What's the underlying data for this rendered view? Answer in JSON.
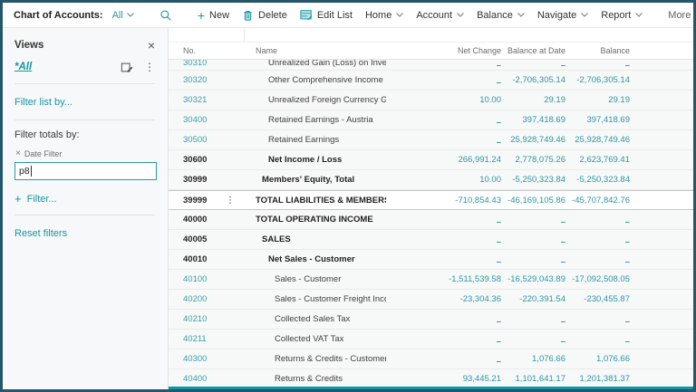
{
  "action_bar": {
    "page_title": "Chart of Accounts:",
    "view_selector": "All",
    "new_label": "New",
    "delete_label": "Delete",
    "edit_list_label": "Edit List",
    "menus": [
      "Home",
      "Account",
      "Balance",
      "Navigate",
      "Report"
    ],
    "more_options_label": "More options"
  },
  "side_pane": {
    "title": "Views",
    "view_all_label": "*All",
    "filter_list_label": "Filter list by...",
    "filter_totals_label": "Filter totals by:",
    "date_filter_chip": "Date Filter",
    "date_filter_value": "p8",
    "add_filter_label": "Filter...",
    "reset_filters_label": "Reset filters"
  },
  "table": {
    "columns": {
      "no": "No.",
      "name": "Name",
      "net_change": "Net Change",
      "balance_at_date": "Balance at Date",
      "balance": "Balance"
    },
    "rows": [
      {
        "no": "30310",
        "name": "Unrealized Gain (Loss) on Investment",
        "net_change": "–",
        "balance_at_date": "–",
        "balance": "–",
        "indent": 2,
        "bold": false,
        "clipped": true
      },
      {
        "no": "30320",
        "name": "Other Comprehensive Income",
        "net_change": "–",
        "balance_at_date": "-2,706,305.14",
        "balance": "-2,706,305.14",
        "indent": 2,
        "bold": false
      },
      {
        "no": "30321",
        "name": "Unrealized Foreign Currency Gain/Loss",
        "net_change": "10.00",
        "balance_at_date": "29.19",
        "balance": "29.19",
        "indent": 2,
        "bold": false
      },
      {
        "no": "30400",
        "name": "Retained Earnings - Austria",
        "net_change": "–",
        "balance_at_date": "397,418.69",
        "balance": "397,418.69",
        "indent": 2,
        "bold": false
      },
      {
        "no": "30500",
        "name": "Retained Earnings",
        "net_change": "–",
        "balance_at_date": "25,928,749.46",
        "balance": "25,928,749.46",
        "indent": 2,
        "bold": false
      },
      {
        "no": "30600",
        "name": "Net Income / Loss",
        "net_change": "266,991.24",
        "balance_at_date": "2,778,075.26",
        "balance": "2,623,769.41",
        "indent": 2,
        "bold": true
      },
      {
        "no": "30999",
        "name": "Members' Equity, Total",
        "net_change": "10.00",
        "balance_at_date": "-5,250,323.84",
        "balance": "-5,250,323.84",
        "indent": 1,
        "bold": true
      },
      {
        "no": "39999",
        "name": "TOTAL LIABILITIES & MEMBERS' EQUITY",
        "net_change": "-710,854.43",
        "balance_at_date": "-46,169,105.86",
        "balance": "-45,707,842.76",
        "indent": 0,
        "bold": true,
        "selected": true
      },
      {
        "no": "40000",
        "name": "TOTAL OPERATING INCOME",
        "net_change": "–",
        "balance_at_date": "–",
        "balance": "–",
        "indent": 0,
        "bold": true
      },
      {
        "no": "40005",
        "name": "SALES",
        "net_change": "–",
        "balance_at_date": "–",
        "balance": "–",
        "indent": 1,
        "bold": true
      },
      {
        "no": "40010",
        "name": "Net Sales - Customer",
        "net_change": "–",
        "balance_at_date": "–",
        "balance": "–",
        "indent": 2,
        "bold": true
      },
      {
        "no": "40100",
        "name": "Sales - Customer",
        "net_change": "-1,511,539.58",
        "balance_at_date": "-16,529,043.89",
        "balance": "-17,092,508.05",
        "indent": 3,
        "bold": false
      },
      {
        "no": "40200",
        "name": "Sales - Customer Freight Income",
        "net_change": "-23,304.36",
        "balance_at_date": "-220,391.54",
        "balance": "-230,455.87",
        "indent": 3,
        "bold": false
      },
      {
        "no": "40210",
        "name": "Collected Sales Tax",
        "net_change": "–",
        "balance_at_date": "–",
        "balance": "–",
        "indent": 3,
        "bold": false
      },
      {
        "no": "40211",
        "name": "Collected VAT Tax",
        "net_change": "–",
        "balance_at_date": "–",
        "balance": "–",
        "indent": 3,
        "bold": false
      },
      {
        "no": "40300",
        "name": "Returns & Credits - Customer Freight",
        "net_change": "–",
        "balance_at_date": "1,076.66",
        "balance": "1,076.66",
        "indent": 3,
        "bold": false
      },
      {
        "no": "40400",
        "name": "Returns & Credits",
        "net_change": "93,445.21",
        "balance_at_date": "1,101,641.17",
        "balance": "1,201,381.37",
        "indent": 3,
        "bold": false
      }
    ]
  },
  "colors": {
    "accent_teal": "#2e96a4",
    "link_teal": "#1795a5",
    "window_border": "#25566b",
    "bottom_strip": "#0f96a6",
    "selected_row_border": "#c6c6c6"
  }
}
